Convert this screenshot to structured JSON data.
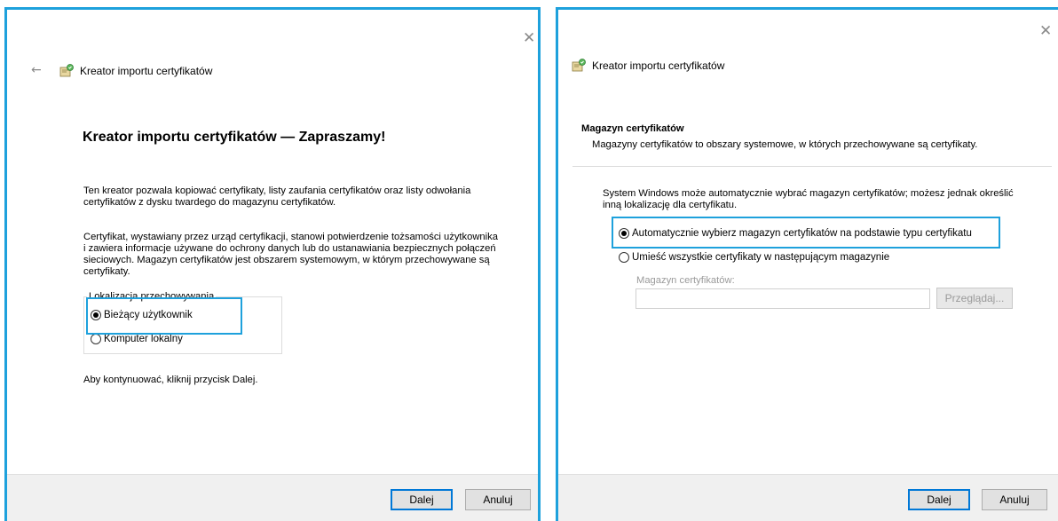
{
  "left_dialog": {
    "title": "Kreator importu certyfikatów",
    "heading": "Kreator importu certyfikatów — Zapraszamy!",
    "intro": "Ten kreator pozwala kopiować certyfikaty, listy zaufania certyfikatów oraz listy odwołania certyfikatów z dysku twardego do magazynu certyfikatów.",
    "description": "Certyfikat, wystawiany przez urząd certyfikacji, stanowi potwierdzenie tożsamości użytkownika i zawiera informacje używane do ochrony danych lub do ustanawiania bezpiecznych połączeń sieciowych. Magazyn certyfikatów jest obszarem systemowym, w którym przechowywane są certyfikaty.",
    "location_group": {
      "label": "Lokalizacja przechowywania",
      "options": [
        {
          "label": "Bieżący użytkownik",
          "checked": true
        },
        {
          "label": "Komputer lokalny",
          "checked": false
        }
      ]
    },
    "continue_text": "Aby kontynuować, kliknij przycisk Dalej.",
    "buttons": {
      "next": "Dalej",
      "cancel": "Anuluj"
    }
  },
  "right_dialog": {
    "title": "Kreator importu certyfikatów",
    "section_title": "Magazyn certyfikatów",
    "section_subtitle": "Magazyny certyfikatów to obszary systemowe, w których przechowywane są certyfikaty.",
    "info_text": "System Windows może automatycznie wybrać magazyn certyfikatów; możesz jednak określić inną lokalizację dla certyfikatu.",
    "options": [
      {
        "label": "Automatycznie wybierz magazyn certyfikatów na podstawie typu certyfikatu",
        "checked": true
      },
      {
        "label": "Umieść wszystkie certyfikaty w następującym magazynie",
        "checked": false
      }
    ],
    "store_label": "Magazyn certyfikatów:",
    "store_value": "",
    "browse_button": "Przeglądaj...",
    "buttons": {
      "next": "Dalej",
      "cancel": "Anuluj"
    }
  },
  "colors": {
    "highlight": "#1ea1dc",
    "default_button_border": "#0078d7"
  }
}
